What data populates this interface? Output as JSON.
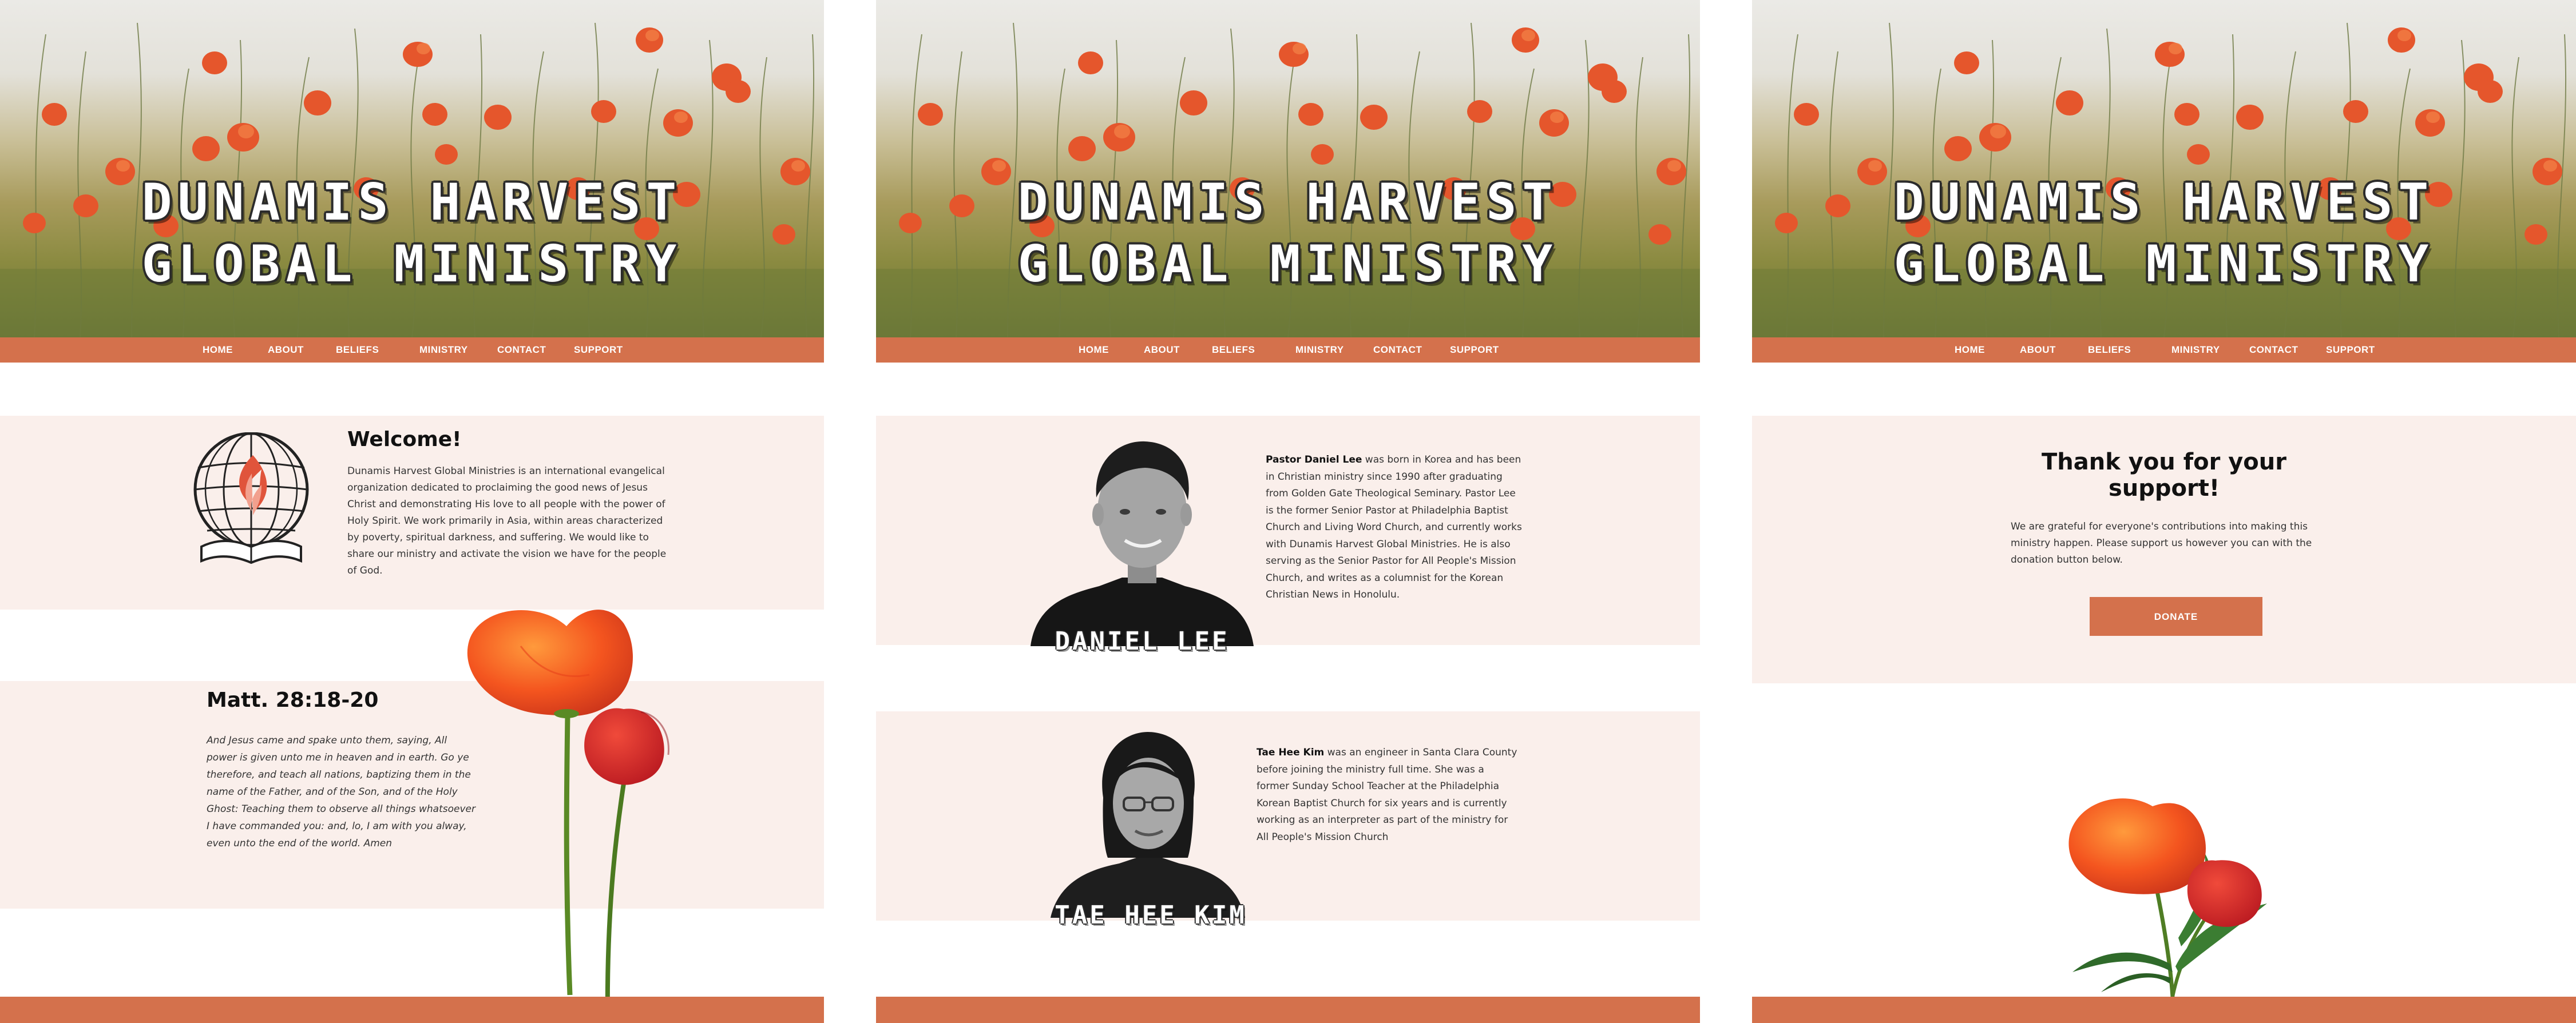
{
  "site": {
    "title_line1": "DUNAMIS HARVEST",
    "title_line2": "GLOBAL MINISTRY"
  },
  "nav": {
    "home": "HOME",
    "about": "ABOUT",
    "beliefs": "BELIEFS",
    "ministry": "MINISTRY",
    "contact": "CONTACT",
    "support": "SUPPORT"
  },
  "colors": {
    "accent": "#d4714c",
    "band": "#faefeb"
  },
  "home": {
    "welcome_title": "Welcome!",
    "welcome_body": "Dunamis Harvest Global Ministries is an international evangelical organization dedicated to proclaiming the good news of Jesus Christ and demonstrating His love to all people with the power of Holy Spirit.  We work primarily in Asia, within areas characterized by poverty, spiritual darkness, and suffering.  We would like to share our ministry and activate the vision we have for the people of God.",
    "verse_ref": "Matt. 28:18-20",
    "verse_text": "And Jesus came and spake unto them, saying, All power is given unto me in heaven and in earth. Go ye therefore, and teach all nations, baptizing them in the name of the Father, and of the Son, and of the Holy Ghost: Teaching them to observe all things whatsoever I have commanded you: and, lo, I am with you alway, even unto the end of the world.  Amen"
  },
  "about": {
    "person1": {
      "name": "Pastor Daniel Lee",
      "bio": " was born in Korea and has been in Christian ministry since 1990 after graduating from Golden Gate Theological Seminary. Pastor Lee is the former Senior Pastor at Philadelphia Baptist Church and Living Word Church, and currently works with Dunamis Harvest Global Ministries. He is also serving as the Senior Pastor for All People's Mission Church, and writes as a columnist for the Korean Christian News in Honolulu.",
      "tag": "DANIEL LEE"
    },
    "person2": {
      "name": "Tae Hee Kim",
      "bio": " was an engineer in Santa Clara County before joining the ministry full time. She was a former Sunday School Teacher at the Philadelphia Korean Baptist Church for six years and is currently working as an interpreter as part of the ministry for All People's Mission Church",
      "tag": "TAE HEE KIM"
    }
  },
  "support": {
    "title_line1": "Thank you for your",
    "title_line2": "support!",
    "body": "We are grateful for everyone's contributions into making this ministry happen. Please support us however you can with the donation button below.",
    "donate_label": "DONATE"
  }
}
